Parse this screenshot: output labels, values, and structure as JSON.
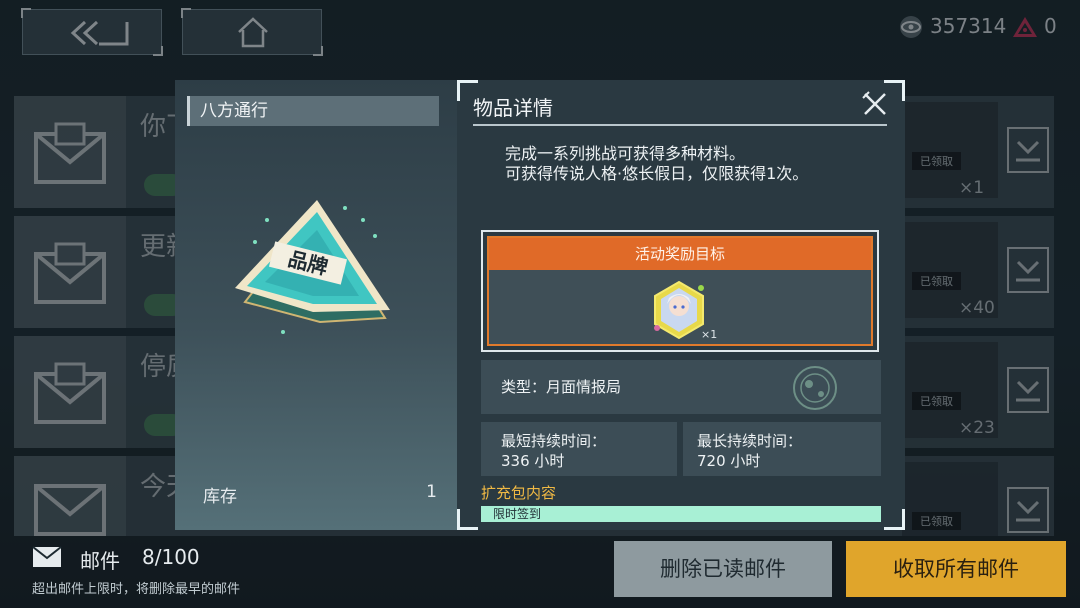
{
  "topbar": {
    "currency1_value": "357314",
    "currency2_value": "0"
  },
  "background_list": [
    {
      "title": "你飞"
    },
    {
      "title": "更新"
    },
    {
      "title": "停质"
    },
    {
      "title": "今天"
    }
  ],
  "background_rewards": [
    {
      "status": "已领取",
      "qty": "×1"
    },
    {
      "status": "已领取",
      "qty": "×40"
    },
    {
      "status": "已领取",
      "qty": "×23"
    },
    {
      "status": "已领取",
      "qty": ""
    }
  ],
  "item_panel": {
    "name": "八方通行",
    "item_text": "品牌",
    "stock_label": "库存",
    "stock_value": "1"
  },
  "detail_panel": {
    "title": "物品详情",
    "description": "完成一系列挑战可获得多种材料。\n可获得传说人格·悠长假日，仅限获得1次。",
    "reward_header": "活动奖励目标",
    "reward_qty": "×1",
    "type_label": "类型：月面情报局",
    "min_duration_label": "最短持续时间：",
    "min_duration_value": "336 小时",
    "max_duration_label": "最长持续时间：",
    "max_duration_value": "720 小时",
    "section_label": "扩充包内容",
    "signin_label": "限时签到"
  },
  "bottom": {
    "mail_label": "邮件",
    "mail_count": "8/100",
    "warning": "超出邮件上限时，将删除最早的邮件",
    "delete_button": "删除已读邮件",
    "collect_button": "收取所有邮件"
  },
  "colors": {
    "accent_orange": "#e06a28",
    "collect_yellow": "#e0a52b",
    "section_gold": "#f0b944",
    "signin_mint": "#a8f0d5"
  }
}
